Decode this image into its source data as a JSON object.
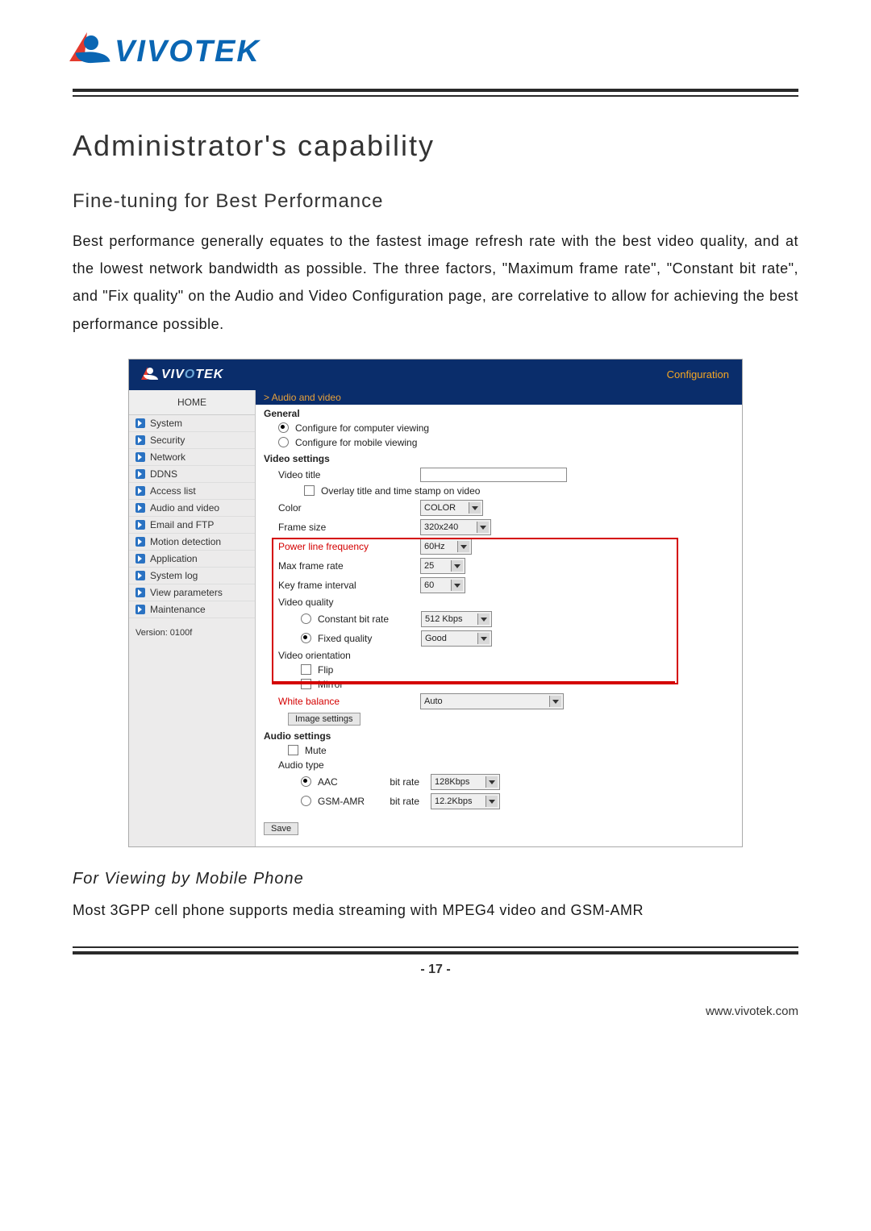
{
  "brand": {
    "name": "VIVOTEK"
  },
  "doc": {
    "title": "Administrator's capability",
    "subtitle": "Fine-tuning for Best Performance",
    "intro": "Best performance generally equates to the fastest image refresh rate with the best video quality, and at the lowest network bandwidth as possible. The three factors, \"Maximum frame rate\", \"Constant bit rate\", and \"Fix quality\" on the Audio and Video Configuration page, are correlative to allow for achieving the best performance possible.",
    "section2_title": "For Viewing by Mobile Phone",
    "section2_body": "Most 3GPP cell phone supports media streaming with MPEG4 video and GSM-AMR",
    "page_number": "- 17 -",
    "url": "www.vivotek.com"
  },
  "config": {
    "header_link": "Configuration",
    "breadcrumb": "> Audio and video",
    "home": "HOME",
    "menu": [
      "System",
      "Security",
      "Network",
      "DDNS",
      "Access list",
      "Audio and video",
      "Email and FTP",
      "Motion detection",
      "Application",
      "System log",
      "View parameters",
      "Maintenance"
    ],
    "version": "Version: 0100f",
    "sections": {
      "general": {
        "title": "General",
        "opt_computer": "Configure for computer viewing",
        "opt_mobile": "Configure for mobile viewing"
      },
      "video": {
        "title": "Video settings",
        "video_title_label": "Video title",
        "video_title_value": "",
        "overlay": "Overlay title and time stamp on video",
        "color_label": "Color",
        "color_value": "COLOR",
        "frame_size_label": "Frame size",
        "frame_size_value": "320x240",
        "power_line_label": "Power line frequency",
        "power_line_value": "60Hz",
        "max_frame_label": "Max frame rate",
        "max_frame_value": "25",
        "key_frame_label": "Key frame interval",
        "key_frame_value": "60",
        "video_quality_label": "Video quality",
        "constant_bit_label": "Constant bit rate",
        "constant_bit_value": "512 Kbps",
        "fixed_quality_label": "Fixed quality",
        "fixed_quality_value": "Good",
        "orientation_label": "Video orientation",
        "flip": "Flip",
        "mirror": "Mirror",
        "white_balance_label": "White balance",
        "white_balance_value": "Auto",
        "image_settings_btn": "Image settings"
      },
      "audio": {
        "title": "Audio settings",
        "mute": "Mute",
        "audio_type_label": "Audio type",
        "aac_label": "AAC",
        "bit_rate_label": "bit rate",
        "aac_value": "128Kbps",
        "gsm_label": "GSM-AMR",
        "gsm_value": "12.2Kbps"
      },
      "save_btn": "Save"
    }
  }
}
